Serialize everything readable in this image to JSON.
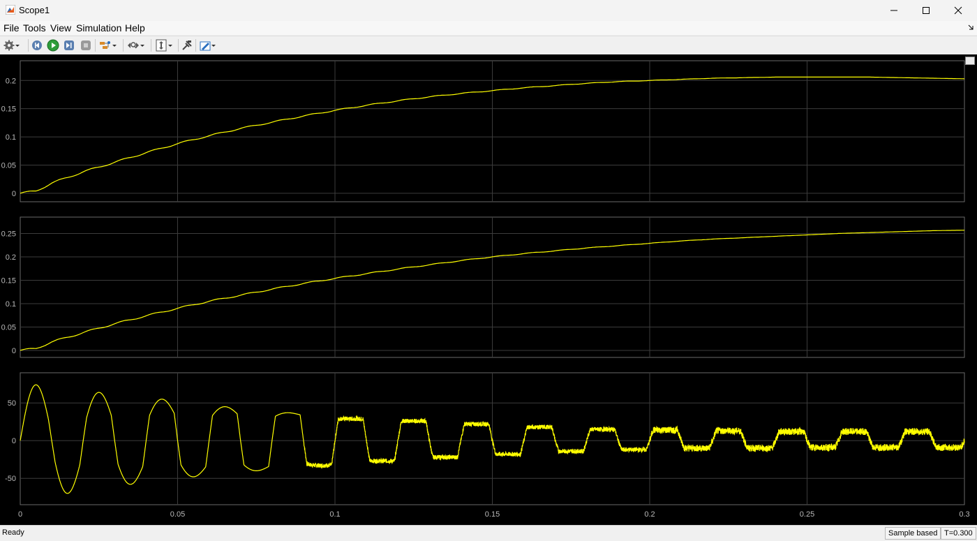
{
  "window": {
    "title": "Scope1"
  },
  "menu": [
    "File",
    "Tools",
    "View",
    "Simulation",
    "Help"
  ],
  "toolbar": {
    "icons": [
      "gear-icon",
      "step-back-icon",
      "run-icon",
      "step-forward-icon",
      "stop-icon",
      "highlight-icon",
      "zoom-icon",
      "autoscale-icon",
      "cursor-measure-icon",
      "style-icon"
    ]
  },
  "colors": {
    "trace": "#ffff00",
    "background": "#000000",
    "axes_bg": "#000000",
    "grid": "#3c3c3c",
    "axis_box": "#6a6a6a",
    "tick_text": "#b9b9b9"
  },
  "status": {
    "left": "Ready",
    "mode": "Sample based",
    "time": "T=0.300"
  },
  "chart_data": [
    {
      "type": "line",
      "xlim": [
        0,
        0.3
      ],
      "ylim": [
        -0.015,
        0.235
      ],
      "xticks": [
        "0",
        "0.05",
        "0.1",
        "0.15",
        "0.2",
        "0.25",
        "0.3"
      ],
      "yticks": [
        "0",
        "0.05",
        "0.1",
        "0.15",
        "0.2"
      ],
      "grid": true,
      "series": [
        {
          "x": [
            0,
            0.005,
            0.01,
            0.02,
            0.03,
            0.04,
            0.05,
            0.06,
            0.07,
            0.08,
            0.09,
            0.1,
            0.11,
            0.12,
            0.13,
            0.14,
            0.15,
            0.16,
            0.17,
            0.18,
            0.19,
            0.2,
            0.21,
            0.22,
            0.23,
            0.24,
            0.25,
            0.26,
            0.27,
            0.28,
            0.29,
            0.3
          ],
          "values": [
            0,
            0.004,
            0.018,
            0.038,
            0.055,
            0.072,
            0.088,
            0.102,
            0.115,
            0.126,
            0.137,
            0.147,
            0.156,
            0.164,
            0.171,
            0.177,
            0.182,
            0.187,
            0.191,
            0.195,
            0.198,
            0.2,
            0.202,
            0.204,
            0.205,
            0.206,
            0.206,
            0.206,
            0.206,
            0.205,
            0.204,
            0.203
          ]
        }
      ]
    },
    {
      "type": "line",
      "xlim": [
        0,
        0.3
      ],
      "ylim": [
        -0.015,
        0.285
      ],
      "xticks": [
        "0",
        "0.05",
        "0.1",
        "0.15",
        "0.2",
        "0.25",
        "0.3"
      ],
      "yticks": [
        "0",
        "0.05",
        "0.1",
        "0.15",
        "0.2",
        "0.25"
      ],
      "grid": true,
      "series": [
        {
          "x": [
            0,
            0.005,
            0.01,
            0.02,
            0.03,
            0.04,
            0.05,
            0.06,
            0.07,
            0.08,
            0.09,
            0.1,
            0.11,
            0.12,
            0.13,
            0.14,
            0.15,
            0.16,
            0.17,
            0.18,
            0.19,
            0.2,
            0.21,
            0.22,
            0.23,
            0.24,
            0.25,
            0.26,
            0.27,
            0.28,
            0.29,
            0.3
          ],
          "values": [
            0,
            0.004,
            0.018,
            0.038,
            0.057,
            0.074,
            0.09,
            0.105,
            0.118,
            0.131,
            0.143,
            0.154,
            0.164,
            0.174,
            0.183,
            0.192,
            0.2,
            0.207,
            0.213,
            0.219,
            0.224,
            0.229,
            0.234,
            0.238,
            0.241,
            0.244,
            0.247,
            0.25,
            0.252,
            0.254,
            0.256,
            0.257
          ]
        }
      ]
    },
    {
      "type": "line",
      "xlim": [
        0,
        0.3
      ],
      "ylim": [
        -85,
        90
      ],
      "xticks": [
        "0",
        "0.05",
        "0.1",
        "0.15",
        "0.2",
        "0.25",
        "0.3"
      ],
      "yticks": [
        "-50",
        "0",
        "50"
      ],
      "grid": true,
      "series": [
        {
          "period": 0.02,
          "cycles_peak_pos": [
            74,
            64,
            55,
            45,
            37,
            29,
            26,
            22,
            18,
            15,
            14,
            13,
            12,
            12,
            12
          ],
          "cycles_peak_neg": [
            -70,
            -58,
            -48,
            -40,
            -33,
            -27,
            -22,
            -18,
            -14,
            -12,
            -10,
            -10,
            -9,
            -9,
            -9
          ],
          "shape": "sine decaying to square/sawtooth with noise"
        }
      ]
    }
  ]
}
